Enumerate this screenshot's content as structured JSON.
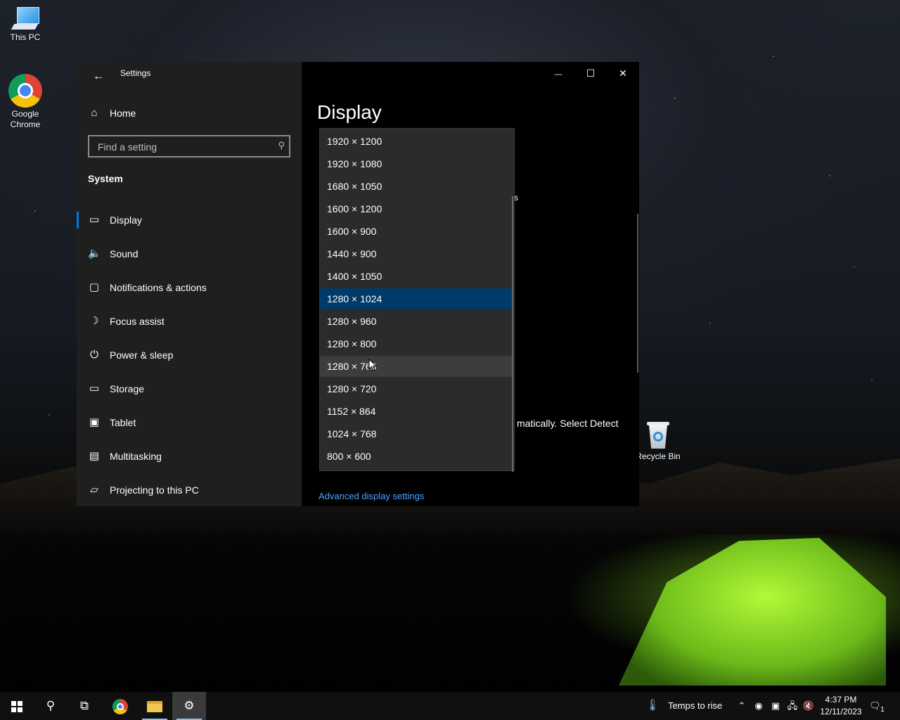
{
  "desktop": {
    "icons": [
      {
        "label": "This PC"
      },
      {
        "label": "Google Chrome"
      },
      {
        "label": "Recycle Bin"
      }
    ]
  },
  "window": {
    "app_title": "Settings",
    "caption_buttons": {
      "minimize": "—",
      "maximize": "☐",
      "close": "✕"
    }
  },
  "nav": {
    "home_label": "Home",
    "search_placeholder": "Find a setting",
    "section_label": "System",
    "items": [
      {
        "label": "Display",
        "icon": "monitor-icon",
        "glyph": "▭",
        "selected": true
      },
      {
        "label": "Sound",
        "icon": "speaker-icon",
        "glyph": "🔈"
      },
      {
        "label": "Notifications & actions",
        "icon": "notification-icon",
        "glyph": "▢"
      },
      {
        "label": "Focus assist",
        "icon": "moon-icon",
        "glyph": "☽"
      },
      {
        "label": "Power & sleep",
        "icon": "power-icon",
        "glyph": "⏻"
      },
      {
        "label": "Storage",
        "icon": "storage-icon",
        "glyph": "▭"
      },
      {
        "label": "Tablet",
        "icon": "tablet-icon",
        "glyph": "▣"
      },
      {
        "label": "Multitasking",
        "icon": "multitasking-icon",
        "glyph": "▤"
      },
      {
        "label": "Projecting to this PC",
        "icon": "projecting-icon",
        "glyph": "▱"
      }
    ]
  },
  "content": {
    "page_title": "Display",
    "partial_text_1": "s",
    "partial_text_2": "matically. Select Detect",
    "advanced_link": "Advanced display settings"
  },
  "resolution_dropdown": {
    "selected_value": "1280 × 1024",
    "hovered_value": "1280 × 768",
    "options": [
      "1920 × 1200",
      "1920 × 1080",
      "1680 × 1050",
      "1600 × 1200",
      "1600 × 900",
      "1440 × 900",
      "1400 × 1050",
      "1280 × 1024",
      "1280 × 960",
      "1280 × 800",
      "1280 × 768",
      "1280 × 720",
      "1152 × 864",
      "1024 × 768",
      "800 × 600"
    ]
  },
  "taskbar": {
    "weather_text": "Temps to rise",
    "time": "4:37 PM",
    "date": "12/11/2023",
    "notification_count": "1"
  },
  "colors": {
    "accent": "#0078d7",
    "selected_option": "#003a68",
    "link": "#4ca3ff"
  }
}
